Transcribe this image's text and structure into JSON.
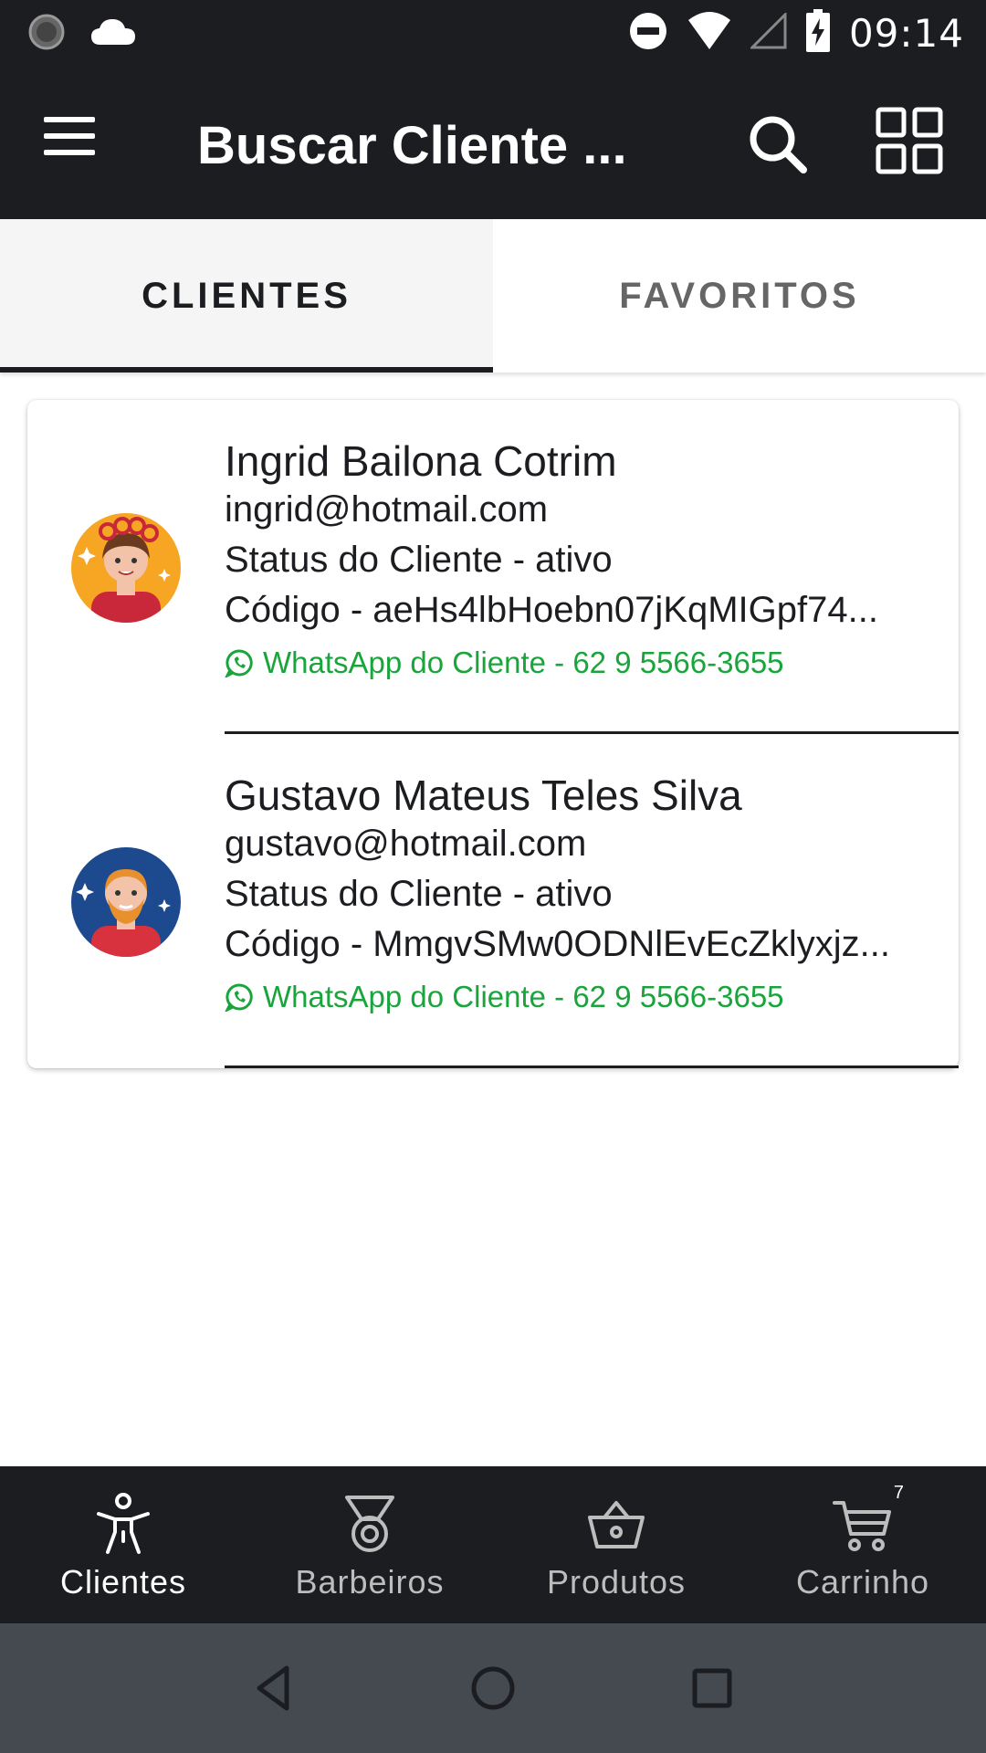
{
  "status_bar": {
    "time": "09:14",
    "icons": [
      "sync-icon",
      "cloud-icon",
      "do-not-disturb-icon",
      "wifi-icon",
      "signal-icon",
      "battery-charging-icon"
    ]
  },
  "app_bar": {
    "title": "Buscar Cliente ...",
    "menu_icon": "hamburger-menu-icon",
    "search_icon": "search-icon",
    "grid_icon": "grid-view-icon"
  },
  "tabs": [
    {
      "label": "CLIENTES",
      "active": true
    },
    {
      "label": "FAVORITOS",
      "active": false
    }
  ],
  "clients": [
    {
      "name": "Ingrid Bailona Cotrim",
      "email": "ingrid@hotmail.com",
      "status": "Status do Cliente - ativo",
      "code": "Código - aeHs4lbHoebn07jKqMIGpf74...",
      "whatsapp": "WhatsApp do Cliente - 62 9 5566-3655",
      "avatar": "female-avatar-icon"
    },
    {
      "name": "Gustavo Mateus Teles Silva",
      "email": "gustavo@hotmail.com",
      "status": "Status do Cliente - ativo",
      "code": "Código - MmgvSMw0ODNlEvEcZklyxjz...",
      "whatsapp": "WhatsApp do Cliente - 62 9 5566-3655",
      "avatar": "male-avatar-icon"
    }
  ],
  "bottom_nav": [
    {
      "label": "Clientes",
      "icon": "person-icon",
      "active": true
    },
    {
      "label": "Barbeiros",
      "icon": "medal-icon",
      "active": false
    },
    {
      "label": "Produtos",
      "icon": "basket-icon",
      "active": false
    },
    {
      "label": "Carrinho",
      "icon": "cart-icon",
      "active": false,
      "badge": "7"
    }
  ],
  "colors": {
    "bar": "#1c1d21",
    "whatsapp_green": "#19a53b",
    "system_nav": "#454a51"
  }
}
